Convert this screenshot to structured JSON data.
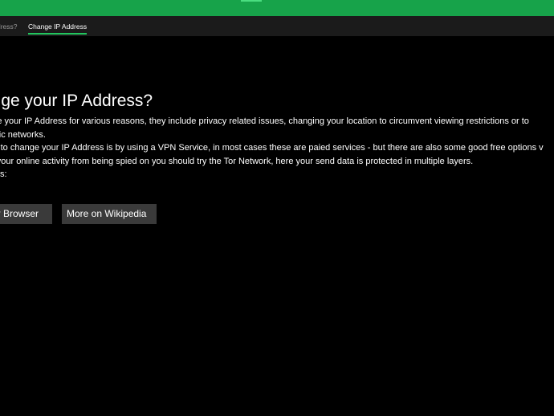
{
  "colors": {
    "titlebar": "#17a34a",
    "tab_underline": "#22c55e",
    "background": "#000000",
    "button": "#3a3a3a"
  },
  "tabs": [
    {
      "label": "dress?",
      "active": false
    },
    {
      "label": "Change IP Address",
      "active": true
    }
  ],
  "main": {
    "heading": "ange your IP Address?",
    "paragraphs": [
      "ange your IP Address for various reasons, they include privacy related issues, changing your location to circumvent viewing restrictions or to",
      " public networks.",
      "way to change your IP Address is by using a VPN Service, in most cases these are paied services - but there are also some good free options v",
      "ide your online activity from being spied on you should try the Tor Network, here your send data is protected in multiple layers.",
      "l links:"
    ]
  },
  "buttons": {
    "tor_browser": "Tor Browser",
    "wikipedia": "More on Wikipedia"
  }
}
